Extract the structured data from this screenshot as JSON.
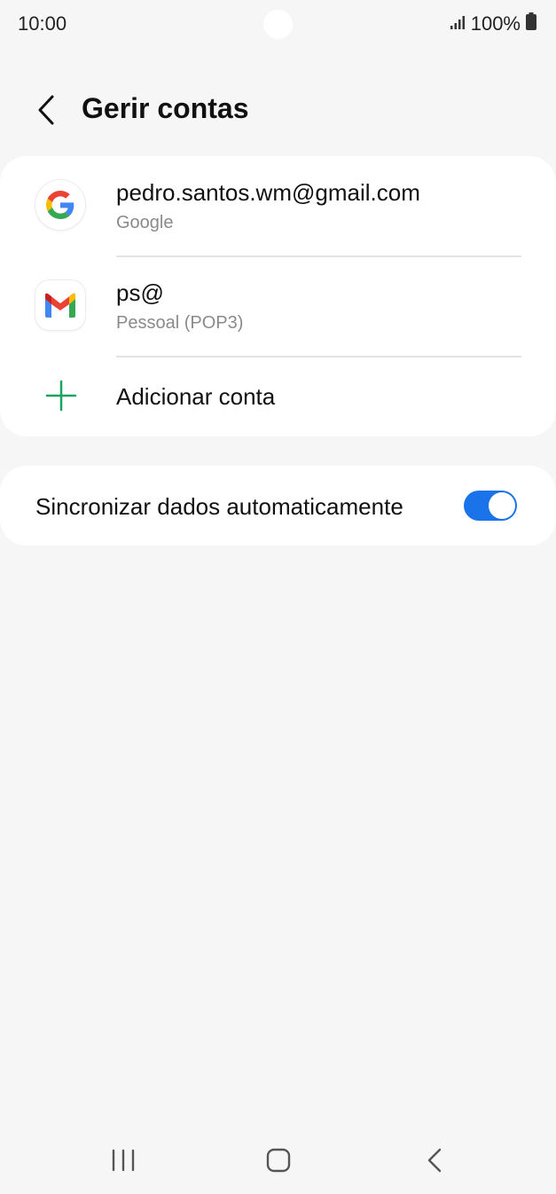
{
  "status_bar": {
    "time": "10:00",
    "battery": "100%"
  },
  "header": {
    "title": "Gerir contas"
  },
  "accounts": [
    {
      "title": "pedro.santos.wm@gmail.com",
      "subtitle": "Google",
      "icon": "google-icon"
    },
    {
      "title": "ps@",
      "subtitle": "Pessoal (POP3)",
      "icon": "gmail-icon"
    }
  ],
  "add_account": {
    "label": "Adicionar conta"
  },
  "sync": {
    "label": "Sincronizar dados automaticamente",
    "enabled": true
  },
  "colors": {
    "accent": "#1a73e8",
    "add_plus": "#1aa260",
    "background": "#f6f6f6"
  }
}
